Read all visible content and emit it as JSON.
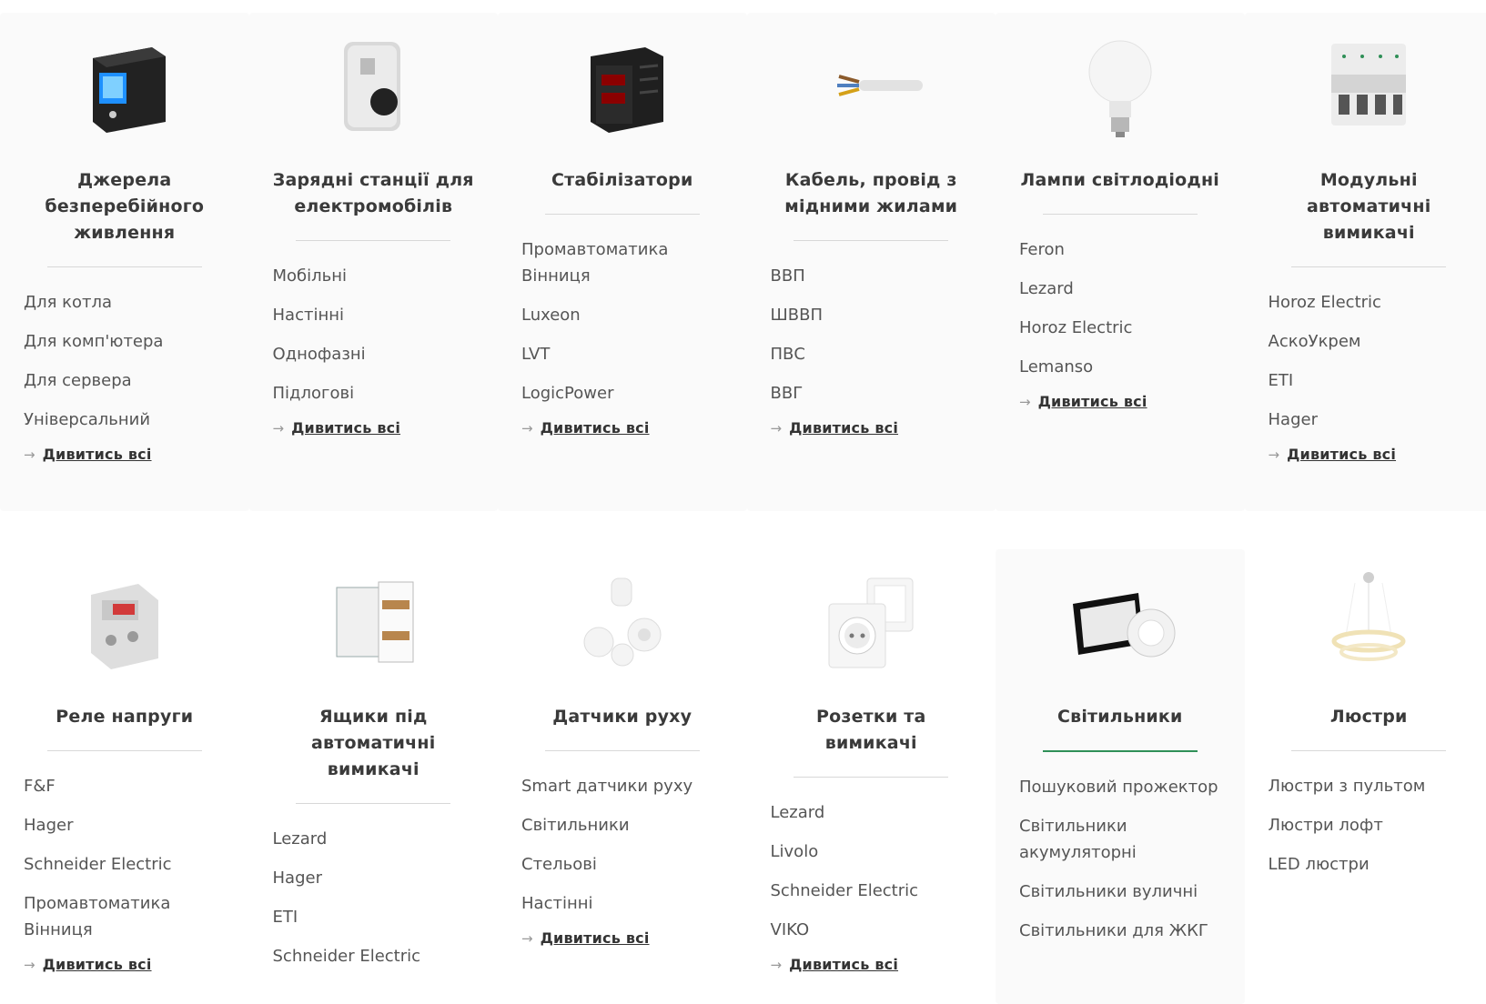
{
  "row1": [
    {
      "title": "Джерела безперебійного живлення",
      "icon": "ups-icon",
      "links": [
        "Для котла",
        "Для комп'ютера",
        "Для сервера",
        "Універсальний"
      ],
      "see_all": "Дивитись всі"
    },
    {
      "title": "Зарядні станції для електромобілів",
      "icon": "ev-charger-icon",
      "links": [
        "Мобільні",
        "Настінні",
        "Однофазні",
        "Підлогові"
      ],
      "see_all": "Дивитись всі"
    },
    {
      "title": "Стабілізатори",
      "icon": "stabilizer-icon",
      "links": [
        "Промавтоматика Вінниця",
        "Luxeon",
        "LVT",
        "LogicPower"
      ],
      "see_all": "Дивитись всі"
    },
    {
      "title": "Кабель, провід з мідними жилами",
      "icon": "cable-icon",
      "links": [
        "ВВП",
        "ШВВП",
        "ПВС",
        "ВВГ"
      ],
      "see_all": "Дивитись всі"
    },
    {
      "title": "Лампи світлодіодні",
      "icon": "led-bulb-icon",
      "links": [
        "Feron",
        "Lezard",
        "Horoz Electric",
        "Lemanso"
      ],
      "see_all": "Дивитись всі"
    },
    {
      "title": "Модульні автоматичні вимикачі",
      "icon": "circuit-breaker-icon",
      "links": [
        "Horoz Electric",
        "АскоУкрем",
        "ETI",
        "Hager"
      ],
      "see_all": "Дивитись всі"
    }
  ],
  "row2": [
    {
      "title": "Реле напруги",
      "icon": "voltage-relay-icon",
      "links": [
        "F&F",
        "Hager",
        "Schneider Electric",
        "Промавтоматика Вінниця"
      ],
      "see_all": "Дивитись всі"
    },
    {
      "title": "Ящики під автоматичні вимикачі",
      "icon": "distribution-box-icon",
      "links": [
        "Lezard",
        "Hager",
        "ETI",
        "Schneider Electric"
      ],
      "see_all": ""
    },
    {
      "title": "Датчики руху",
      "icon": "motion-sensor-icon",
      "links": [
        "Smart датчики руху",
        "Світильники",
        "Стельові",
        "Настінні"
      ],
      "see_all": "Дивитись всі"
    },
    {
      "title": "Розетки та вимикачі",
      "icon": "socket-icon",
      "links": [
        "Lezard",
        "Livolo",
        "Schneider Electric",
        "VIKO"
      ],
      "see_all": "Дивитись всі"
    },
    {
      "title": "Світильники",
      "icon": "floodlight-icon",
      "links": [
        "Пошуковий прожектор",
        "Світильники акумуляторні",
        "Світильники вуличні",
        "Світильники для ЖКГ"
      ],
      "see_all": ""
    },
    {
      "title": "Люстри",
      "icon": "chandelier-icon",
      "links": [
        "Люстри з пультом",
        "Люстри лофт",
        "LED люстри"
      ],
      "see_all": ""
    }
  ],
  "colors": {
    "accent": "#2f8f57",
    "card_bg": "#fafafa",
    "divider": "#d8d8d8"
  }
}
